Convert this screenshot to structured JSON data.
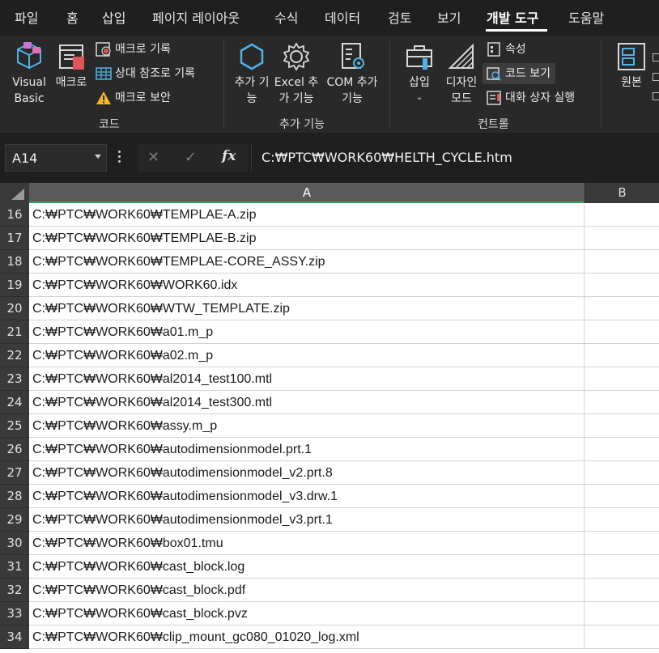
{
  "tabs": [
    "파일",
    "홈",
    "삽입",
    "페이지 레이아웃",
    "수식",
    "데이터",
    "검토",
    "보기",
    "개발 도구",
    "도움말"
  ],
  "active_tab": "개발 도구",
  "ribbon": {
    "code": {
      "visual_basic": "Visual Basic",
      "macro": "매크로",
      "record_macro": "매크로 기록",
      "relative_ref": "상대 참조로 기록",
      "macro_security": "매크로 보안",
      "label": "코드"
    },
    "addins": {
      "addins": "추가 기능",
      "excel_addins": "Excel 추가 기능",
      "com_addins": "COM 추가 기능",
      "label": "추가 기능"
    },
    "controls": {
      "insert": "삽입",
      "design_mode": "디자인 모드",
      "properties": "속성",
      "view_code": "코드 보기",
      "run_dialog": "대화 상자 실행",
      "label": "컨트롤"
    },
    "source": "원본"
  },
  "formula_bar": {
    "name_box": "A14",
    "fx": "fx",
    "value": "C:₩PTC₩WORK60₩HELTH_CYCLE.htm"
  },
  "columns": [
    "A",
    "B"
  ],
  "rows": [
    {
      "num": "16",
      "a": "C:₩PTC₩WORK60₩TEMPLAE-A.zip"
    },
    {
      "num": "17",
      "a": "C:₩PTC₩WORK60₩TEMPLAE-B.zip"
    },
    {
      "num": "18",
      "a": "C:₩PTC₩WORK60₩TEMPLAE-CORE_ASSY.zip"
    },
    {
      "num": "19",
      "a": "C:₩PTC₩WORK60₩WORK60.idx"
    },
    {
      "num": "20",
      "a": "C:₩PTC₩WORK60₩WTW_TEMPLATE.zip"
    },
    {
      "num": "21",
      "a": "C:₩PTC₩WORK60₩a01.m_p"
    },
    {
      "num": "22",
      "a": "C:₩PTC₩WORK60₩a02.m_p"
    },
    {
      "num": "23",
      "a": "C:₩PTC₩WORK60₩al2014_test100.mtl"
    },
    {
      "num": "24",
      "a": "C:₩PTC₩WORK60₩al2014_test300.mtl"
    },
    {
      "num": "25",
      "a": "C:₩PTC₩WORK60₩assy.m_p"
    },
    {
      "num": "26",
      "a": "C:₩PTC₩WORK60₩autodimensionmodel.prt.1"
    },
    {
      "num": "27",
      "a": "C:₩PTC₩WORK60₩autodimensionmodel_v2.prt.8"
    },
    {
      "num": "28",
      "a": "C:₩PTC₩WORK60₩autodimensionmodel_v3.drw.1"
    },
    {
      "num": "29",
      "a": "C:₩PTC₩WORK60₩autodimensionmodel_v3.prt.1"
    },
    {
      "num": "30",
      "a": "C:₩PTC₩WORK60₩box01.tmu"
    },
    {
      "num": "31",
      "a": "C:₩PTC₩WORK60₩cast_block.log"
    },
    {
      "num": "32",
      "a": "C:₩PTC₩WORK60₩cast_block.pdf"
    },
    {
      "num": "33",
      "a": "C:₩PTC₩WORK60₩cast_block.pvz"
    },
    {
      "num": "34",
      "a": "C:₩PTC₩WORK60₩clip_mount_gc080_01020_log.xml"
    }
  ]
}
